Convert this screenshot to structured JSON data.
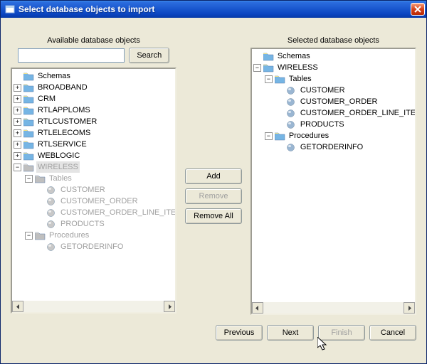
{
  "window": {
    "title": "Select database objects to import"
  },
  "left_panel": {
    "title": "Available database objects",
    "search": {
      "placeholder": "",
      "value": "",
      "button_label": "Search"
    },
    "root": "Schemas",
    "schemas": [
      "BROADBAND",
      "CRM",
      "RTLAPPLOMS",
      "RTLCUSTOMER",
      "RTLELECOMS",
      "RTLSERVICE",
      "WEBLOGIC"
    ],
    "disabled_schema": {
      "name": "WIRELESS",
      "groups": [
        {
          "name": "Tables",
          "items": [
            "CUSTOMER",
            "CUSTOMER_ORDER",
            "CUSTOMER_ORDER_LINE_ITEM",
            "PRODUCTS"
          ]
        },
        {
          "name": "Procedures",
          "items": [
            "GETORDERINFO"
          ]
        }
      ]
    }
  },
  "actions": {
    "add": "Add",
    "remove": "Remove",
    "remove_all": "Remove All"
  },
  "right_panel": {
    "title": "Selected database objects",
    "root": "Schemas",
    "schema": {
      "name": "WIRELESS",
      "groups": [
        {
          "name": "Tables",
          "items": [
            "CUSTOMER",
            "CUSTOMER_ORDER",
            "CUSTOMER_ORDER_LINE_ITEM",
            "PRODUCTS"
          ]
        },
        {
          "name": "Procedures",
          "items": [
            "GETORDERINFO"
          ]
        }
      ]
    }
  },
  "footer": {
    "previous": "Previous",
    "next": "Next",
    "finish": "Finish",
    "cancel": "Cancel"
  }
}
